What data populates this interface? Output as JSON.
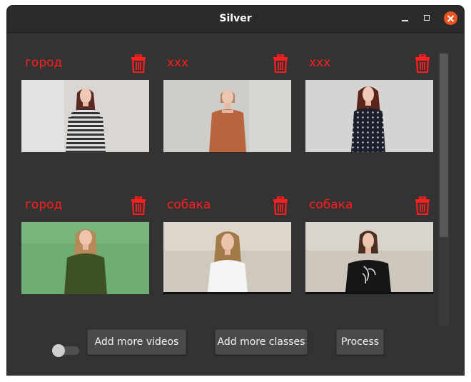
{
  "window": {
    "title": "Silver",
    "accent": "#e95420"
  },
  "classes": [
    {
      "label": "город",
      "thumbnail": "woman-striped-sweater"
    },
    {
      "label": "xxx",
      "thumbnail": "woman-orange-sweater"
    },
    {
      "label": "xxx",
      "thumbnail": "woman-polka-dot-top"
    },
    {
      "label": "город",
      "thumbnail": "woman-green-screen"
    },
    {
      "label": "собака",
      "thumbnail": "woman-white-top"
    },
    {
      "label": "собака",
      "thumbnail": "woman-black-flower-top"
    }
  ],
  "label_color": "#ff1e1e",
  "controls": {
    "toggle_state": "off",
    "add_videos_label": "Add more videos",
    "add_classes_label": "Add more classes",
    "process_label": "Process"
  }
}
